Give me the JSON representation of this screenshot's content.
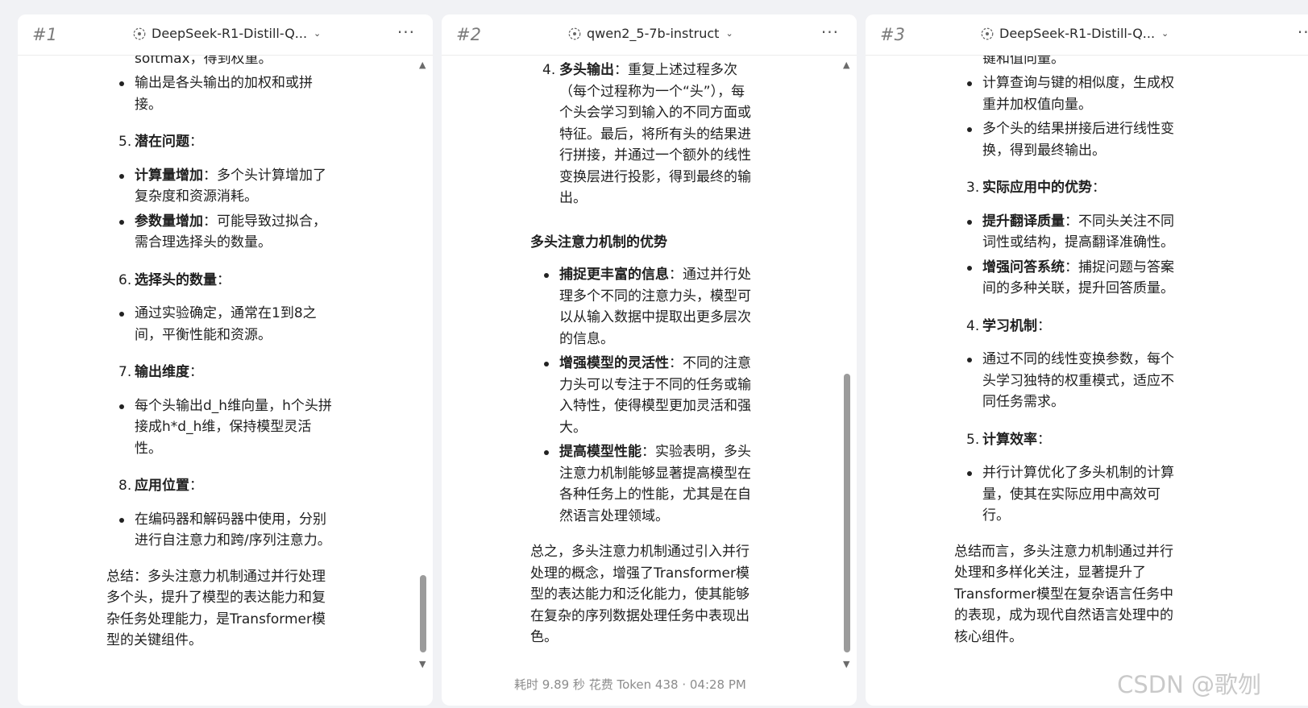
{
  "panels": [
    {
      "number": "#1",
      "model": "DeepSeek-R1-Distill-Q...",
      "menu": "···",
      "partial_top": "softmax，得到权重。",
      "items": [
        {
          "type": "bullet",
          "lines": [
            "输出是各头输出的加权和或拼",
            "接。"
          ]
        },
        {
          "type": "num",
          "n": "5.",
          "title": "潜在问题",
          "colon": "："
        },
        {
          "type": "bullet",
          "bold": "计算量增加",
          "lines": [
            "：多个头计算增加了",
            "复杂度和资源消耗。"
          ]
        },
        {
          "type": "bullet",
          "bold": "参数量增加",
          "lines": [
            "：可能导致过拟合，",
            "需合理选择头的数量。"
          ]
        },
        {
          "type": "num",
          "n": "6.",
          "title": "选择头的数量",
          "colon": "："
        },
        {
          "type": "bullet",
          "lines": [
            "通过实验确定，通常在1到8之",
            "间，平衡性能和资源。"
          ]
        },
        {
          "type": "num",
          "n": "7.",
          "title": "输出维度",
          "colon": "："
        },
        {
          "type": "bullet",
          "lines": [
            "每个头输出d_h维向量，h个头拼",
            "接成h*d_h维，保持模型灵活",
            "性。"
          ]
        },
        {
          "type": "num",
          "n": "8.",
          "title": "应用位置",
          "colon": "："
        },
        {
          "type": "bullet",
          "lines": [
            "在编码器和解码器中使用，分别",
            "进行自注意力和跨/序列注意力。"
          ]
        }
      ],
      "summary": [
        "总结：多头注意力机制通过并行处理",
        "多个头，提升了模型的表达能力和复",
        "杂任务处理能力，是Transformer模",
        "型的关键组件。"
      ]
    },
    {
      "number": "#2",
      "model": "qwen2_5-7b-instruct",
      "menu": "···",
      "top_num": "4.",
      "top_bold": "多头输出",
      "top_lines": [
        "：重复上述过程多次",
        "（每个过程称为一个“头”），每",
        "个头会学习到输入的不同方面或",
        "特征。最后，将所有头的结果进",
        "行拼接，并通过一个额外的线性",
        "变换层进行投影，得到最终的输",
        "出。"
      ],
      "section": "多头注意力机制的优势",
      "items": [
        {
          "bold": "捕捉更丰富的信息",
          "lines": [
            "：通过并行处",
            "理多个不同的注意力头，模型可",
            "以从输入数据中提取出更多层次",
            "的信息。"
          ]
        },
        {
          "bold": "增强模型的灵活性",
          "lines": [
            "：不同的注意",
            "力头可以专注于不同的任务或输",
            "入特性，使得模型更加灵活和强",
            "大。"
          ]
        },
        {
          "bold": "提高模型性能",
          "lines": [
            "：实验表明，多头",
            "注意力机制能够显著提高模型在",
            "各种任务上的性能，尤其是在自",
            "然语言处理领域。"
          ]
        }
      ],
      "summary": [
        "总之，多头注意力机制通过引入并行",
        "处理的概念，增强了Transformer模",
        "型的表达能力和泛化能力，使其能够",
        "在复杂的序列数据处理任务中表现出",
        "色。"
      ],
      "footer": "耗时 9.89 秒  花费 Token 438  ·  04:28 PM"
    },
    {
      "number": "#3",
      "model": "DeepSeek-R1-Distill-Q...",
      "menu": "···",
      "partial_top": "键和值向量。",
      "items": [
        {
          "type": "bullet",
          "lines": [
            "计算查询与键的相似度，生成权",
            "重并加权值向量。"
          ]
        },
        {
          "type": "bullet",
          "lines": [
            "多个头的结果拼接后进行线性变",
            "换，得到最终输出。"
          ]
        },
        {
          "type": "num",
          "n": "3.",
          "title": "实际应用中的优势",
          "colon": "："
        },
        {
          "type": "bullet",
          "bold": "提升翻译质量",
          "lines": [
            "：不同头关注不同",
            "词性或结构，提高翻译准确性。"
          ]
        },
        {
          "type": "bullet",
          "bold": "增强问答系统",
          "lines": [
            "：捕捉问题与答案",
            "间的多种关联，提升回答质量。"
          ]
        },
        {
          "type": "num",
          "n": "4.",
          "title": "学习机制",
          "colon": "："
        },
        {
          "type": "bullet",
          "lines": [
            "通过不同的线性变换参数，每个",
            "头学习独特的权重模式，适应不",
            "同任务需求。"
          ]
        },
        {
          "type": "num",
          "n": "5.",
          "title": "计算效率",
          "colon": "："
        },
        {
          "type": "bullet",
          "lines": [
            "并行计算优化了多头机制的计算",
            "量，使其在实际应用中高效可",
            "行。"
          ]
        }
      ],
      "summary": [
        "总结而言，多头注意力机制通过并行",
        "处理和多样化关注，显著提升了",
        "Transformer模型在复杂语言任务中",
        "的表现，成为现代自然语言处理中的",
        "核心组件。"
      ]
    }
  ],
  "watermark": "CSDN @歌刎",
  "icons": {
    "model": "model-logo-icon",
    "chevron": "chevron-down-icon",
    "menu": "more-icon",
    "up": "scroll-up-icon",
    "down": "scroll-down-icon"
  },
  "colors": {
    "background": "#f1f2f5",
    "panel": "#ffffff",
    "scrollbar": "#9b9b9b"
  }
}
